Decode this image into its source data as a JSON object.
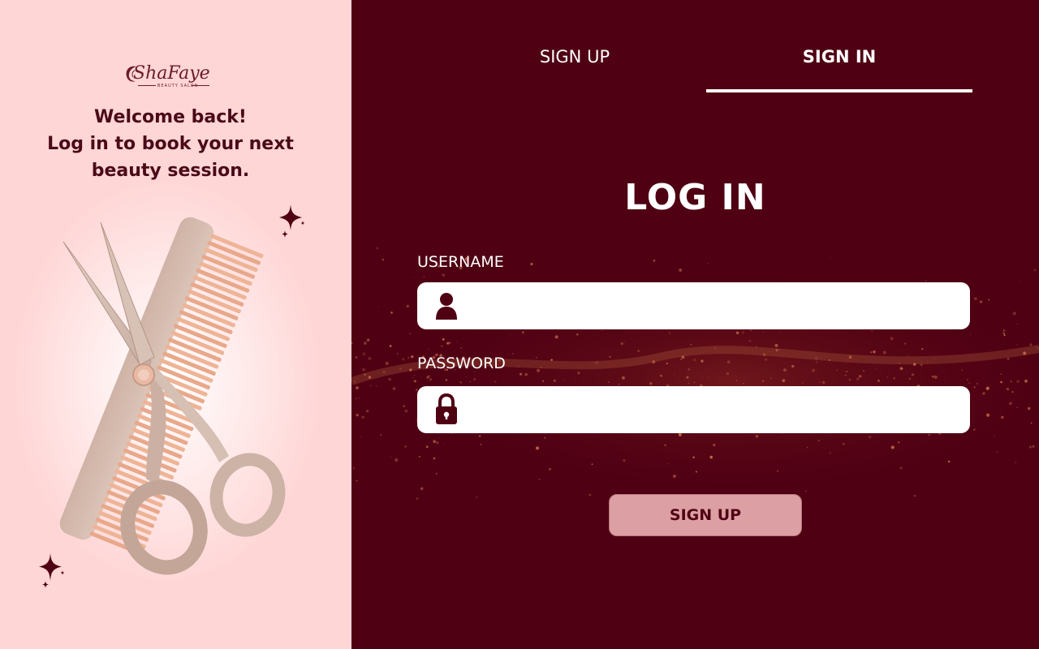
{
  "brand": {
    "logo_text": "ShaFaye",
    "logo_subtitle": "BEAUTY SALON"
  },
  "welcome": {
    "line1": "Welcome back!",
    "line2": "Log in to book your next",
    "line3": "beauty session."
  },
  "tabs": {
    "signup_label": "SIGN UP",
    "signin_label": "SIGN IN",
    "active": "signin"
  },
  "form": {
    "heading": "LOG IN",
    "username_label": "USERNAME",
    "username_value": "",
    "password_label": "PASSWORD",
    "password_value": "",
    "submit_label": "SIGN UP"
  },
  "icons": {
    "username": "user-icon",
    "password": "lock-icon"
  },
  "colors": {
    "left_bg": "#ffd6d6",
    "right_bg": "#4f0013",
    "accent_text": "#4a0a18",
    "button_bg": "#dc9fa3",
    "field_bg": "#ffffff"
  }
}
